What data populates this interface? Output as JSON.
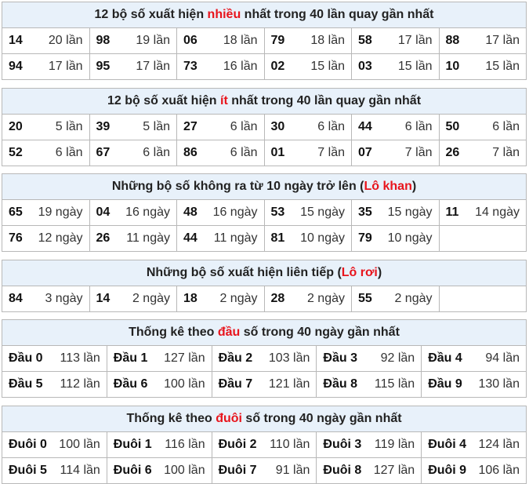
{
  "most": {
    "title_pre": "12 bộ số xuất hiện ",
    "title_hl": "nhiều",
    "title_post": " nhất trong 40 lần quay gần nhất",
    "rows": [
      [
        [
          "14",
          "20 lần"
        ],
        [
          "98",
          "19 lần"
        ],
        [
          "06",
          "18 lần"
        ],
        [
          "79",
          "18 lần"
        ],
        [
          "58",
          "17 lần"
        ],
        [
          "88",
          "17 lần"
        ]
      ],
      [
        [
          "94",
          "17 lần"
        ],
        [
          "95",
          "17 lần"
        ],
        [
          "73",
          "16 lần"
        ],
        [
          "02",
          "15 lần"
        ],
        [
          "03",
          "15 lần"
        ],
        [
          "10",
          "15 lần"
        ]
      ]
    ]
  },
  "least": {
    "title_pre": "12 bộ số xuất hiện ",
    "title_hl": "ít",
    "title_post": " nhất trong 40 lần quay gần nhất",
    "rows": [
      [
        [
          "20",
          "5 lần"
        ],
        [
          "39",
          "5 lần"
        ],
        [
          "27",
          "6 lần"
        ],
        [
          "30",
          "6 lần"
        ],
        [
          "44",
          "6 lần"
        ],
        [
          "50",
          "6 lần"
        ]
      ],
      [
        [
          "52",
          "6 lần"
        ],
        [
          "67",
          "6 lần"
        ],
        [
          "86",
          "6 lần"
        ],
        [
          "01",
          "7 lần"
        ],
        [
          "07",
          "7 lần"
        ],
        [
          "26",
          "7 lần"
        ]
      ]
    ]
  },
  "khan": {
    "title_pre": "Những bộ số không ra từ 10 ngày trở lên (",
    "title_hl": "Lô khan",
    "title_post": ")",
    "rows": [
      [
        [
          "65",
          "19 ngày"
        ],
        [
          "04",
          "16 ngày"
        ],
        [
          "48",
          "16 ngày"
        ],
        [
          "53",
          "15 ngày"
        ],
        [
          "35",
          "15 ngày"
        ],
        [
          "11",
          "14 ngày"
        ]
      ],
      [
        [
          "76",
          "12 ngày"
        ],
        [
          "26",
          "11 ngày"
        ],
        [
          "44",
          "11 ngày"
        ],
        [
          "81",
          "10 ngày"
        ],
        [
          "79",
          "10 ngày"
        ],
        [
          "",
          ""
        ]
      ]
    ]
  },
  "roi": {
    "title_pre": "Những bộ số xuất hiện liên tiếp (",
    "title_hl": "Lô rơi",
    "title_post": ")",
    "rows": [
      [
        [
          "84",
          "3 ngày"
        ],
        [
          "14",
          "2 ngày"
        ],
        [
          "18",
          "2 ngày"
        ],
        [
          "28",
          "2 ngày"
        ],
        [
          "55",
          "2 ngày"
        ],
        [
          "",
          ""
        ]
      ]
    ]
  },
  "dau": {
    "title_pre": "Thống kê theo ",
    "title_hl": "đầu",
    "title_post": " số trong 40 ngày gần nhất",
    "rows": [
      [
        [
          "Đầu 0",
          "113 lần"
        ],
        [
          "Đầu 1",
          "127 lần"
        ],
        [
          "Đầu 2",
          "103 lần"
        ],
        [
          "Đầu 3",
          "92 lần"
        ],
        [
          "Đầu 4",
          "94 lần"
        ]
      ],
      [
        [
          "Đầu 5",
          "112 lần"
        ],
        [
          "Đầu 6",
          "100 lần"
        ],
        [
          "Đầu 7",
          "121 lần"
        ],
        [
          "Đầu 8",
          "115 lần"
        ],
        [
          "Đầu 9",
          "130 lần"
        ]
      ]
    ]
  },
  "duoi": {
    "title_pre": "Thống kê theo ",
    "title_hl": "đuôi",
    "title_post": " số trong 40 ngày gần nhất",
    "rows": [
      [
        [
          "Đuôi 0",
          "100 lần"
        ],
        [
          "Đuôi 1",
          "116 lần"
        ],
        [
          "Đuôi 2",
          "110 lần"
        ],
        [
          "Đuôi 3",
          "119 lần"
        ],
        [
          "Đuôi 4",
          "124 lần"
        ]
      ],
      [
        [
          "Đuôi 5",
          "114 lần"
        ],
        [
          "Đuôi 6",
          "100 lần"
        ],
        [
          "Đuôi 7",
          "91 lần"
        ],
        [
          "Đuôi 8",
          "127 lần"
        ],
        [
          "Đuôi 9",
          "106 lần"
        ]
      ]
    ]
  }
}
